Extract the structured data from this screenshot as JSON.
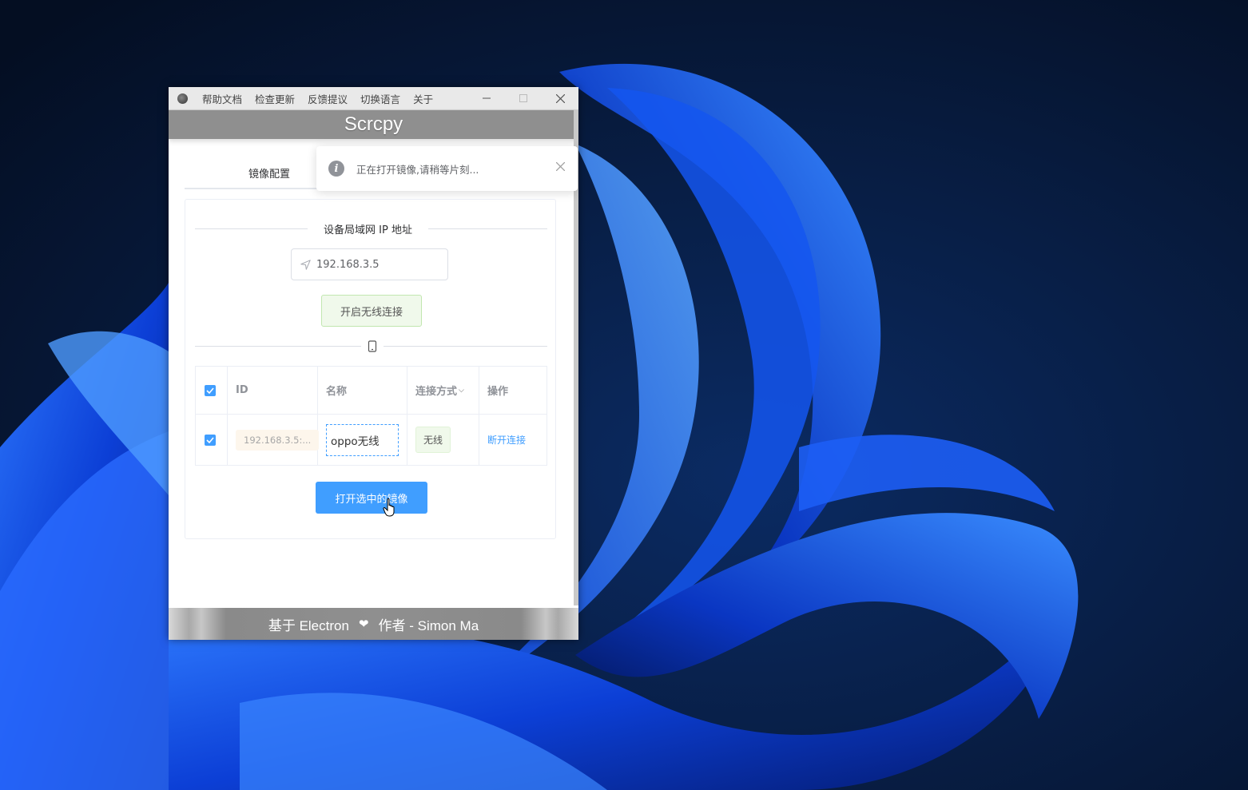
{
  "menu": {
    "items": [
      "帮助文档",
      "检查更新",
      "反馈提议",
      "切换语言",
      "关于"
    ]
  },
  "app_title": "Scrcpy",
  "tabs": [
    {
      "label": "镜像配置",
      "active": true
    }
  ],
  "notification": {
    "icon": "info-icon",
    "message": "正在打开镜像,请稍等片刻..."
  },
  "ip_section": {
    "divider_label": "设备局域网 IP 地址",
    "input_value": "192.168.3.5",
    "connect_button": "开启无线连接"
  },
  "devices_section": {
    "divider_icon": "phone-icon",
    "table": {
      "columns": [
        "",
        "ID",
        "名称",
        "连接方式",
        "操作"
      ],
      "rows": [
        {
          "checked": true,
          "id": "192.168.3.5:...",
          "name": "oppo无线",
          "connection": "无线",
          "action": "断开连接"
        }
      ]
    },
    "open_button": "打开选中的镜像"
  },
  "footer": {
    "prefix": "基于 Electron",
    "suffix": "作者 - Simon Ma"
  },
  "colors": {
    "primary": "#409eff",
    "success_bg": "#f0f9eb",
    "warning_bg": "#fdf6ec",
    "titlebar": "#8f8f8f"
  }
}
